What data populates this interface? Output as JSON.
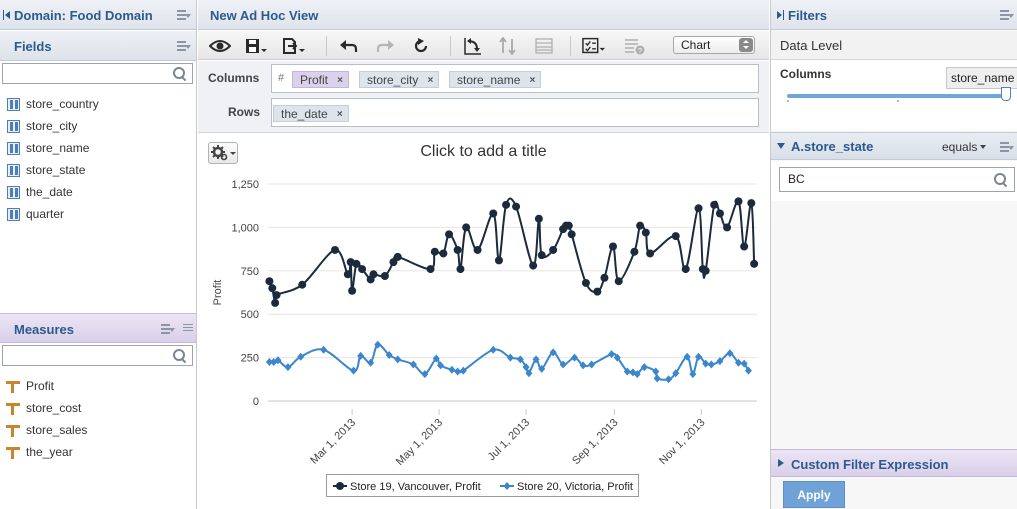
{
  "left_panel": {
    "domain_title": "Domain: Food Domain",
    "fields_title": "Fields",
    "search_fields_value": "",
    "fields": [
      {
        "label": "store_country"
      },
      {
        "label": "store_city"
      },
      {
        "label": "store_name"
      },
      {
        "label": "store_state"
      },
      {
        "label": "the_date"
      },
      {
        "label": "quarter"
      }
    ],
    "measures_title": "Measures",
    "search_measures_value": "",
    "measures": [
      {
        "label": "Profit"
      },
      {
        "label": "store_cost"
      },
      {
        "label": "store_sales"
      },
      {
        "label": "the_year"
      }
    ]
  },
  "center": {
    "view_title": "New Ad Hoc View",
    "toolbar": {
      "icons": [
        "eye-icon",
        "save-icon",
        "export-icon",
        "undo-icon",
        "redo-icon",
        "undo-all-icon",
        "switch-axes-icon",
        "sort-icon",
        "table-icon",
        "check-list-icon",
        "query-icon"
      ],
      "view_type": "Chart"
    },
    "columns_label": "Columns",
    "rows_label": "Rows",
    "columns": [
      {
        "label": "Profit",
        "kind": "measure"
      },
      {
        "label": "store_city",
        "kind": "field"
      },
      {
        "label": "store_name",
        "kind": "field"
      }
    ],
    "rows": [
      {
        "label": "the_date",
        "kind": "field"
      }
    ],
    "chart_title_placeholder": "Click to add a title"
  },
  "chart_data": {
    "type": "line",
    "title": "Click to add a title",
    "ylabel": "Profit",
    "xlabel": "",
    "ylim": [
      0,
      1250
    ],
    "yticks": [
      0,
      250,
      500,
      750,
      1000,
      1250
    ],
    "xticks": [
      {
        "label": "Mar 1, 2013",
        "date": "2013-03-01"
      },
      {
        "label": "May 1, 2013",
        "date": "2013-05-01"
      },
      {
        "label": "Jul 1, 2013",
        "date": "2013-07-01"
      },
      {
        "label": "Sep 1, 2013",
        "date": "2013-09-01"
      },
      {
        "label": "Nov 1, 2013",
        "date": "2013-11-01"
      }
    ],
    "grid": "horizontal",
    "legend": "bottom",
    "series": [
      {
        "name": "Store 19, Vancouver, Profit",
        "color": "#1b2a3d",
        "marker": "circle",
        "points": [
          [
            "2013-01-02",
            690
          ],
          [
            "2013-01-04",
            650
          ],
          [
            "2013-01-06",
            565
          ],
          [
            "2013-01-07",
            610
          ],
          [
            "2013-01-25",
            670
          ],
          [
            "2013-02-17",
            870
          ],
          [
            "2013-02-26",
            730
          ],
          [
            "2013-02-28",
            800
          ],
          [
            "2013-03-01",
            635
          ],
          [
            "2013-03-04",
            790
          ],
          [
            "2013-03-08",
            760
          ],
          [
            "2013-03-14",
            700
          ],
          [
            "2013-03-16",
            730
          ],
          [
            "2013-03-24",
            720
          ],
          [
            "2013-03-30",
            800
          ],
          [
            "2013-04-02",
            830
          ],
          [
            "2013-04-25",
            760
          ],
          [
            "2013-04-28",
            860
          ],
          [
            "2013-05-04",
            850
          ],
          [
            "2013-05-08",
            960
          ],
          [
            "2013-05-14",
            870
          ],
          [
            "2013-05-16",
            760
          ],
          [
            "2013-05-20",
            1000
          ],
          [
            "2013-05-28",
            870
          ],
          [
            "2013-06-08",
            1080
          ],
          [
            "2013-06-12",
            810
          ],
          [
            "2013-06-17",
            1130
          ],
          [
            "2013-06-24",
            1120
          ],
          [
            "2013-07-06",
            780
          ],
          [
            "2013-07-10",
            1050
          ],
          [
            "2013-07-12",
            840
          ],
          [
            "2013-07-20",
            870
          ],
          [
            "2013-07-27",
            990
          ],
          [
            "2013-07-29",
            1010
          ],
          [
            "2013-07-31",
            1010
          ],
          [
            "2013-08-02",
            960
          ],
          [
            "2013-08-12",
            680
          ],
          [
            "2013-08-20",
            630
          ],
          [
            "2013-08-25",
            710
          ],
          [
            "2013-08-31",
            890
          ],
          [
            "2013-09-04",
            690
          ],
          [
            "2013-09-15",
            860
          ],
          [
            "2013-09-19",
            1010
          ],
          [
            "2013-09-23",
            970
          ],
          [
            "2013-09-26",
            850
          ],
          [
            "2013-10-14",
            950
          ],
          [
            "2013-10-21",
            760
          ],
          [
            "2013-10-30",
            1110
          ],
          [
            "2013-11-02",
            760
          ],
          [
            "2013-11-04",
            750
          ],
          [
            "2013-11-10",
            1130
          ],
          [
            "2013-11-14",
            1080
          ],
          [
            "2013-11-19",
            1000
          ],
          [
            "2013-11-27",
            1150
          ],
          [
            "2013-12-01",
            890
          ],
          [
            "2013-12-06",
            1140
          ],
          [
            "2013-12-08",
            790
          ]
        ]
      },
      {
        "name": "Store 20, Victoria, Profit",
        "color": "#3b86cc",
        "marker": "diamond",
        "points": [
          [
            "2013-01-02",
            225
          ],
          [
            "2013-01-05",
            225
          ],
          [
            "2013-01-08",
            235
          ],
          [
            "2013-01-15",
            195
          ],
          [
            "2013-01-24",
            255
          ],
          [
            "2013-02-09",
            295
          ],
          [
            "2013-03-02",
            175
          ],
          [
            "2013-03-07",
            260
          ],
          [
            "2013-03-14",
            220
          ],
          [
            "2013-03-19",
            325
          ],
          [
            "2013-03-27",
            265
          ],
          [
            "2013-04-02",
            240
          ],
          [
            "2013-04-13",
            210
          ],
          [
            "2013-04-21",
            155
          ],
          [
            "2013-04-29",
            245
          ],
          [
            "2013-05-02",
            205
          ],
          [
            "2013-05-10",
            180
          ],
          [
            "2013-05-14",
            170
          ],
          [
            "2013-05-18",
            175
          ],
          [
            "2013-06-08",
            295
          ],
          [
            "2013-06-20",
            250
          ],
          [
            "2013-06-27",
            240
          ],
          [
            "2013-07-01",
            195
          ],
          [
            "2013-07-03",
            160
          ],
          [
            "2013-07-08",
            240
          ],
          [
            "2013-07-12",
            185
          ],
          [
            "2013-07-20",
            280
          ],
          [
            "2013-07-27",
            210
          ],
          [
            "2013-08-04",
            250
          ],
          [
            "2013-08-10",
            205
          ],
          [
            "2013-08-16",
            210
          ],
          [
            "2013-08-30",
            270
          ],
          [
            "2013-09-03",
            250
          ],
          [
            "2013-09-10",
            170
          ],
          [
            "2013-09-14",
            165
          ],
          [
            "2013-09-17",
            155
          ],
          [
            "2013-09-22",
            195
          ],
          [
            "2013-09-30",
            170
          ],
          [
            "2013-10-01",
            130
          ],
          [
            "2013-10-09",
            125
          ],
          [
            "2013-10-14",
            160
          ],
          [
            "2013-10-22",
            255
          ],
          [
            "2013-10-26",
            155
          ],
          [
            "2013-10-30",
            255
          ],
          [
            "2013-11-04",
            215
          ],
          [
            "2013-11-08",
            210
          ],
          [
            "2013-11-14",
            230
          ],
          [
            "2013-11-21",
            275
          ],
          [
            "2013-11-27",
            220
          ],
          [
            "2013-12-01",
            215
          ],
          [
            "2013-12-04",
            175
          ]
        ]
      }
    ]
  },
  "right_panel": {
    "filters_title": "Filters",
    "data_level_label": "Data Level",
    "columns_label": "Columns",
    "data_level_value": "store_name",
    "filter_field": "A.store_state",
    "filter_operator": "equals",
    "filter_value": "BC",
    "custom_filter_label": "Custom Filter Expression",
    "apply_label": "Apply"
  }
}
